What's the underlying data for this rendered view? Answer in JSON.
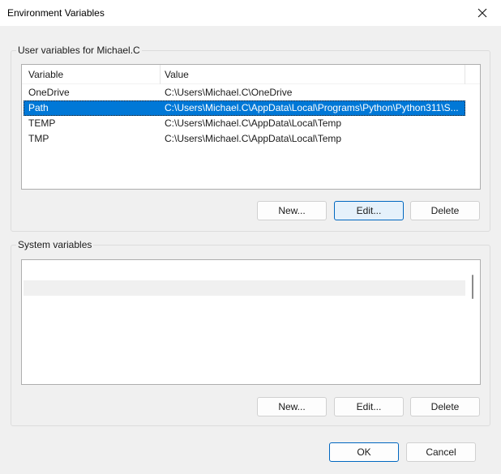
{
  "window": {
    "title": "Environment Variables",
    "close_label": "Close"
  },
  "user_vars": {
    "group_label": "User variables for Michael.C",
    "columns": {
      "variable": "Variable",
      "value": "Value"
    },
    "rows": [
      {
        "variable": "OneDrive",
        "value": "C:\\Users\\Michael.C\\OneDrive",
        "selected": false
      },
      {
        "variable": "Path",
        "value": "C:\\Users\\Michael.C\\AppData\\Local\\Programs\\Python\\Python311\\S...",
        "selected": true
      },
      {
        "variable": "TEMP",
        "value": "C:\\Users\\Michael.C\\AppData\\Local\\Temp",
        "selected": false
      },
      {
        "variable": "TMP",
        "value": "C:\\Users\\Michael.C\\AppData\\Local\\Temp",
        "selected": false
      }
    ],
    "buttons": {
      "new": "New...",
      "edit": "Edit...",
      "delete": "Delete"
    }
  },
  "system_vars": {
    "group_label": "System variables",
    "buttons": {
      "new": "New...",
      "edit": "Edit...",
      "delete": "Delete"
    }
  },
  "dialog_buttons": {
    "ok": "OK",
    "cancel": "Cancel"
  },
  "colors": {
    "selection": "#0078d7",
    "focus_border": "#0067c0",
    "window_bg": "#f0f0f0"
  }
}
